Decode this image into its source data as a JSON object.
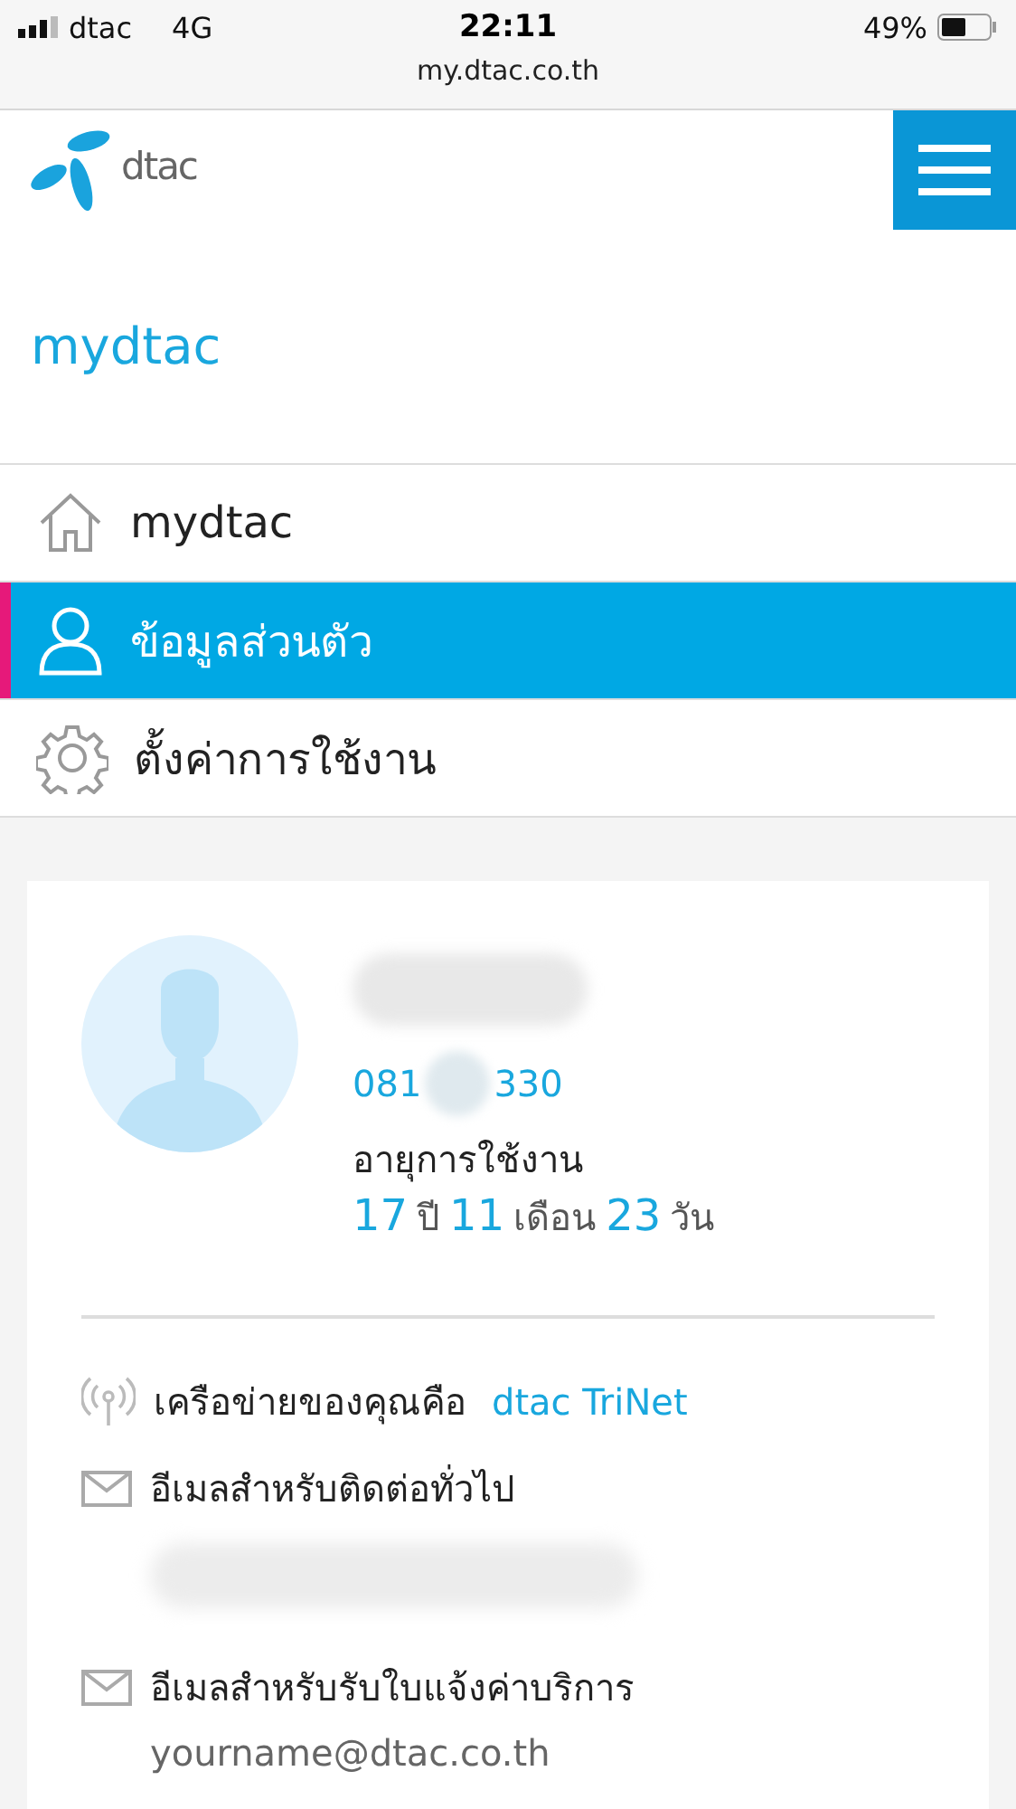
{
  "status_bar": {
    "carrier": "dtac",
    "network": "4G",
    "time": "22:11",
    "battery": "49%",
    "url": "my.dtac.co.th"
  },
  "header": {
    "logo_text": "dtac"
  },
  "page_title": "mydtac",
  "menu": [
    {
      "kind": "home",
      "label": "mydtac",
      "selected": false
    },
    {
      "kind": "person",
      "label": "ข้อมูลส่วนตัว",
      "selected": true
    },
    {
      "kind": "gear",
      "label": "ตั้งค่าการใช้งาน",
      "selected": false
    }
  ],
  "profile": {
    "phone_start": "081",
    "phone_end": "330",
    "usage_label": "อายุการใช้งาน",
    "usage": [
      {
        "kind": "number",
        "text": "17"
      },
      {
        "kind": "unit",
        "text": "ปี"
      },
      {
        "kind": "number",
        "text": "11"
      },
      {
        "kind": "unit",
        "text": "เดือน"
      },
      {
        "kind": "number",
        "text": "23"
      },
      {
        "kind": "unit",
        "text": "วัน"
      }
    ]
  },
  "details": [
    {
      "kind": "network",
      "label": "เครือข่ายของคุณคือ",
      "value": "dtac TriNet"
    },
    {
      "kind": "email",
      "label": "อีเมลสำหรับติดต่อทั่วไป"
    },
    {
      "kind": "email",
      "label": "อีเมลสำหรับรับใบแจ้งค่าบริการ",
      "value": "yourname@dtac.co.th"
    }
  ]
}
